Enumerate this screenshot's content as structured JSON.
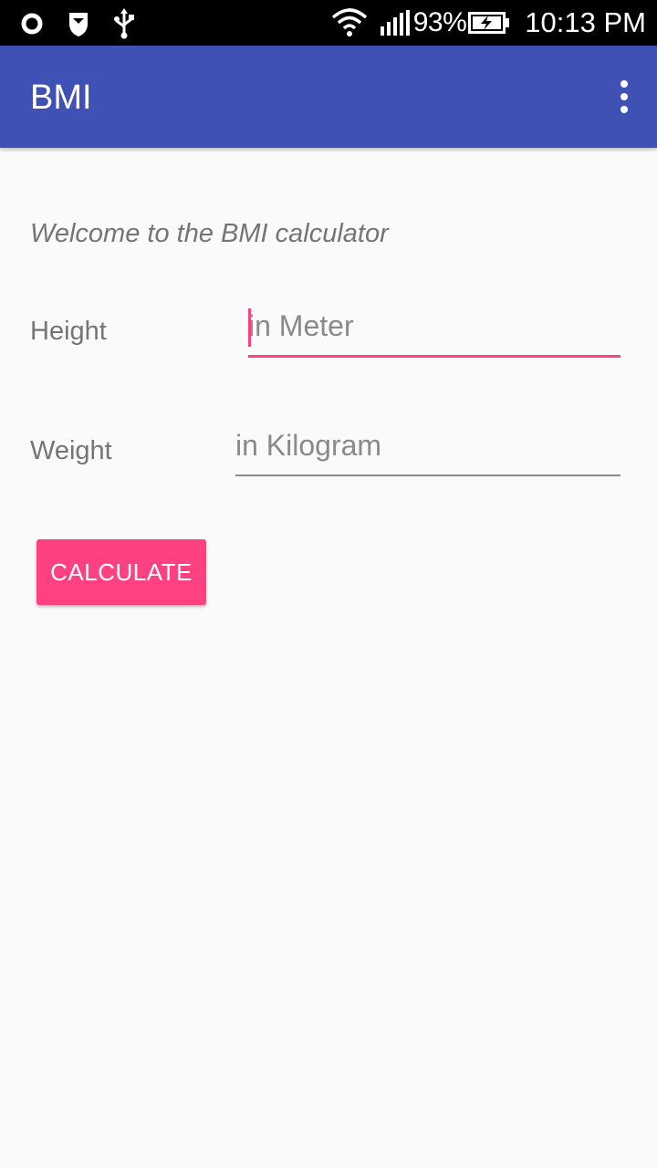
{
  "status_bar": {
    "battery_percent": "93%",
    "time": "10:13 PM",
    "icons": [
      "circle-notification-icon",
      "shield-icon",
      "usb-icon",
      "wifi-icon",
      "signal-icon",
      "battery-charging-icon"
    ]
  },
  "app_bar": {
    "title": "BMI",
    "color": "#3f51b5"
  },
  "form": {
    "welcome_text": "Welcome to the BMI calculator",
    "height_label": "Height",
    "height_placeholder": "in Meter",
    "height_value": "",
    "weight_label": "Weight",
    "weight_placeholder": "in Kilogram",
    "weight_value": "",
    "calculate_label": "CALCULATE",
    "accent_color": "#ff4081"
  }
}
